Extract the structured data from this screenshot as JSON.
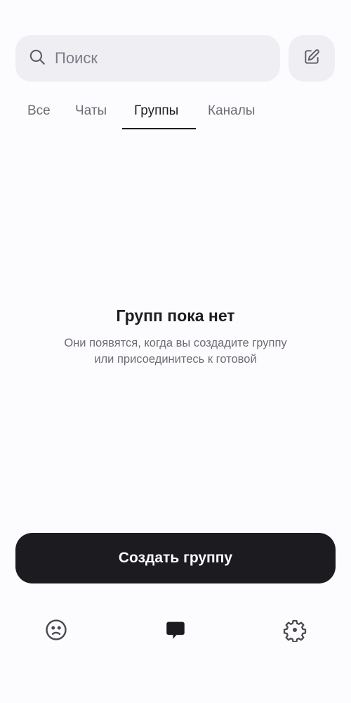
{
  "search": {
    "placeholder": "Поиск",
    "icon": "search-icon"
  },
  "compose": {
    "icon": "compose-icon"
  },
  "tabs": [
    {
      "label": "Все",
      "active": false
    },
    {
      "label": "Чаты",
      "active": false
    },
    {
      "label": "Группы",
      "active": true
    },
    {
      "label": "Каналы",
      "active": false
    }
  ],
  "empty_state": {
    "title": "Групп пока нет",
    "description_line1": "Они появятся, когда вы создадите группу",
    "description_line2": "или присоединитесь к готовой"
  },
  "create_button": {
    "label": "Создать группу"
  },
  "bottom_nav": [
    {
      "icon": "profile-icon",
      "active": false
    },
    {
      "icon": "chat-icon",
      "active": true
    },
    {
      "icon": "settings-icon",
      "active": false
    }
  ],
  "colors": {
    "background": "#fcfbfd",
    "surface": "#efeef3",
    "primary": "#1c1b20",
    "muted_text": "#6e6d76"
  }
}
